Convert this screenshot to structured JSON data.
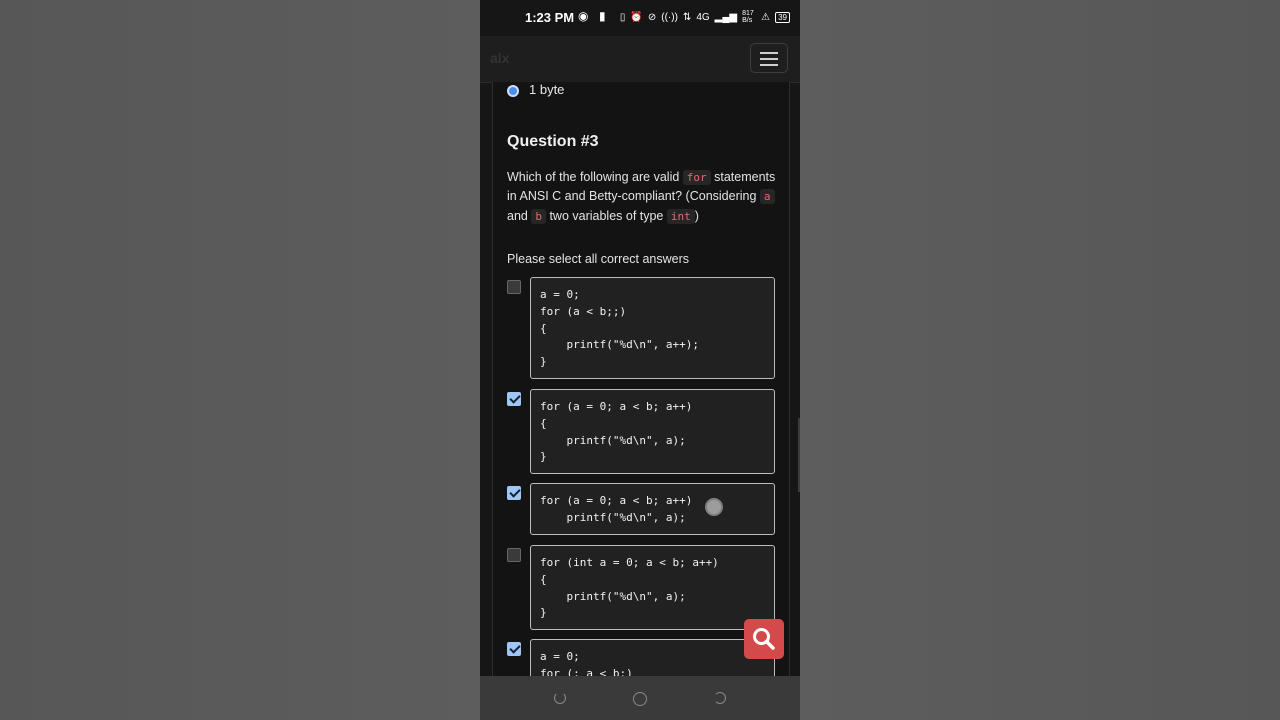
{
  "status_bar": {
    "time": "1:23 PM",
    "network_speed": "817 B/s",
    "network_type": "4G",
    "battery": "39"
  },
  "navbar": {
    "logo": "alx"
  },
  "previous_question": {
    "selected_option_label": "1 byte"
  },
  "question": {
    "title": "Question #3",
    "text_part1": "Which of the following are valid ",
    "code_for": "for",
    "text_part2": " statements in ANSI C and Betty-compliant? (Considering ",
    "code_a": "a",
    "text_and": " and ",
    "code_b": "b",
    "text_part3": " two variables of type ",
    "code_int": "int",
    "text_end": ")",
    "select_hint": "Please select all correct answers"
  },
  "answers": [
    {
      "checked": false,
      "code": "a = 0;\nfor (a < b;;)\n{\n    printf(\"%d\\n\", a++);\n}"
    },
    {
      "checked": true,
      "code": "for (a = 0; a < b; a++)\n{\n    printf(\"%d\\n\", a);\n}"
    },
    {
      "checked": true,
      "code": "for (a = 0; a < b; a++)\n    printf(\"%d\\n\", a);"
    },
    {
      "checked": false,
      "code": "for (int a = 0; a < b; a++)\n{\n    printf(\"%d\\n\", a);\n}"
    },
    {
      "checked": true,
      "code": "a = 0;\nfor (; a < b;)"
    }
  ],
  "icons": {
    "search_fab": "search-icon",
    "menu": "hamburger-icon"
  },
  "colors": {
    "checkbox_checked": "#9fc6f7",
    "code_inline": "#e06c6c",
    "search_fab": "#d44a4a",
    "radio_selected": "#4a8df0"
  }
}
